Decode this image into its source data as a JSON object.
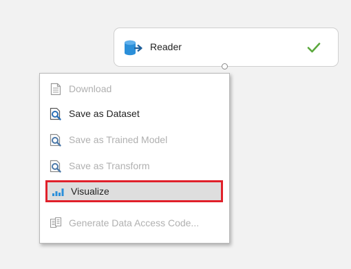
{
  "module": {
    "title": "Reader",
    "icon": "database-export-icon",
    "status_icon": "checkmark-icon",
    "colors": {
      "icon": "#2b8fd9",
      "check": "#5aa83c"
    }
  },
  "context_menu": {
    "items": [
      {
        "label": "Download",
        "icon": "document-icon",
        "enabled": false
      },
      {
        "label": "Save as Dataset",
        "icon": "save-dataset-icon",
        "enabled": true
      },
      {
        "label": "Save as Trained Model",
        "icon": "save-model-icon",
        "enabled": false
      },
      {
        "label": "Save as Transform",
        "icon": "save-transform-icon",
        "enabled": false
      },
      {
        "label": "Visualize",
        "icon": "bar-chart-icon",
        "enabled": true,
        "highlighted": true
      },
      {
        "label": "Generate Data Access Code...",
        "icon": "code-copy-icon",
        "enabled": false
      }
    ],
    "colors": {
      "highlight_border": "#e0202a",
      "highlight_bg": "#dedede",
      "disabled_text": "#b0b0b0",
      "accent": "#2b8fd9"
    }
  }
}
